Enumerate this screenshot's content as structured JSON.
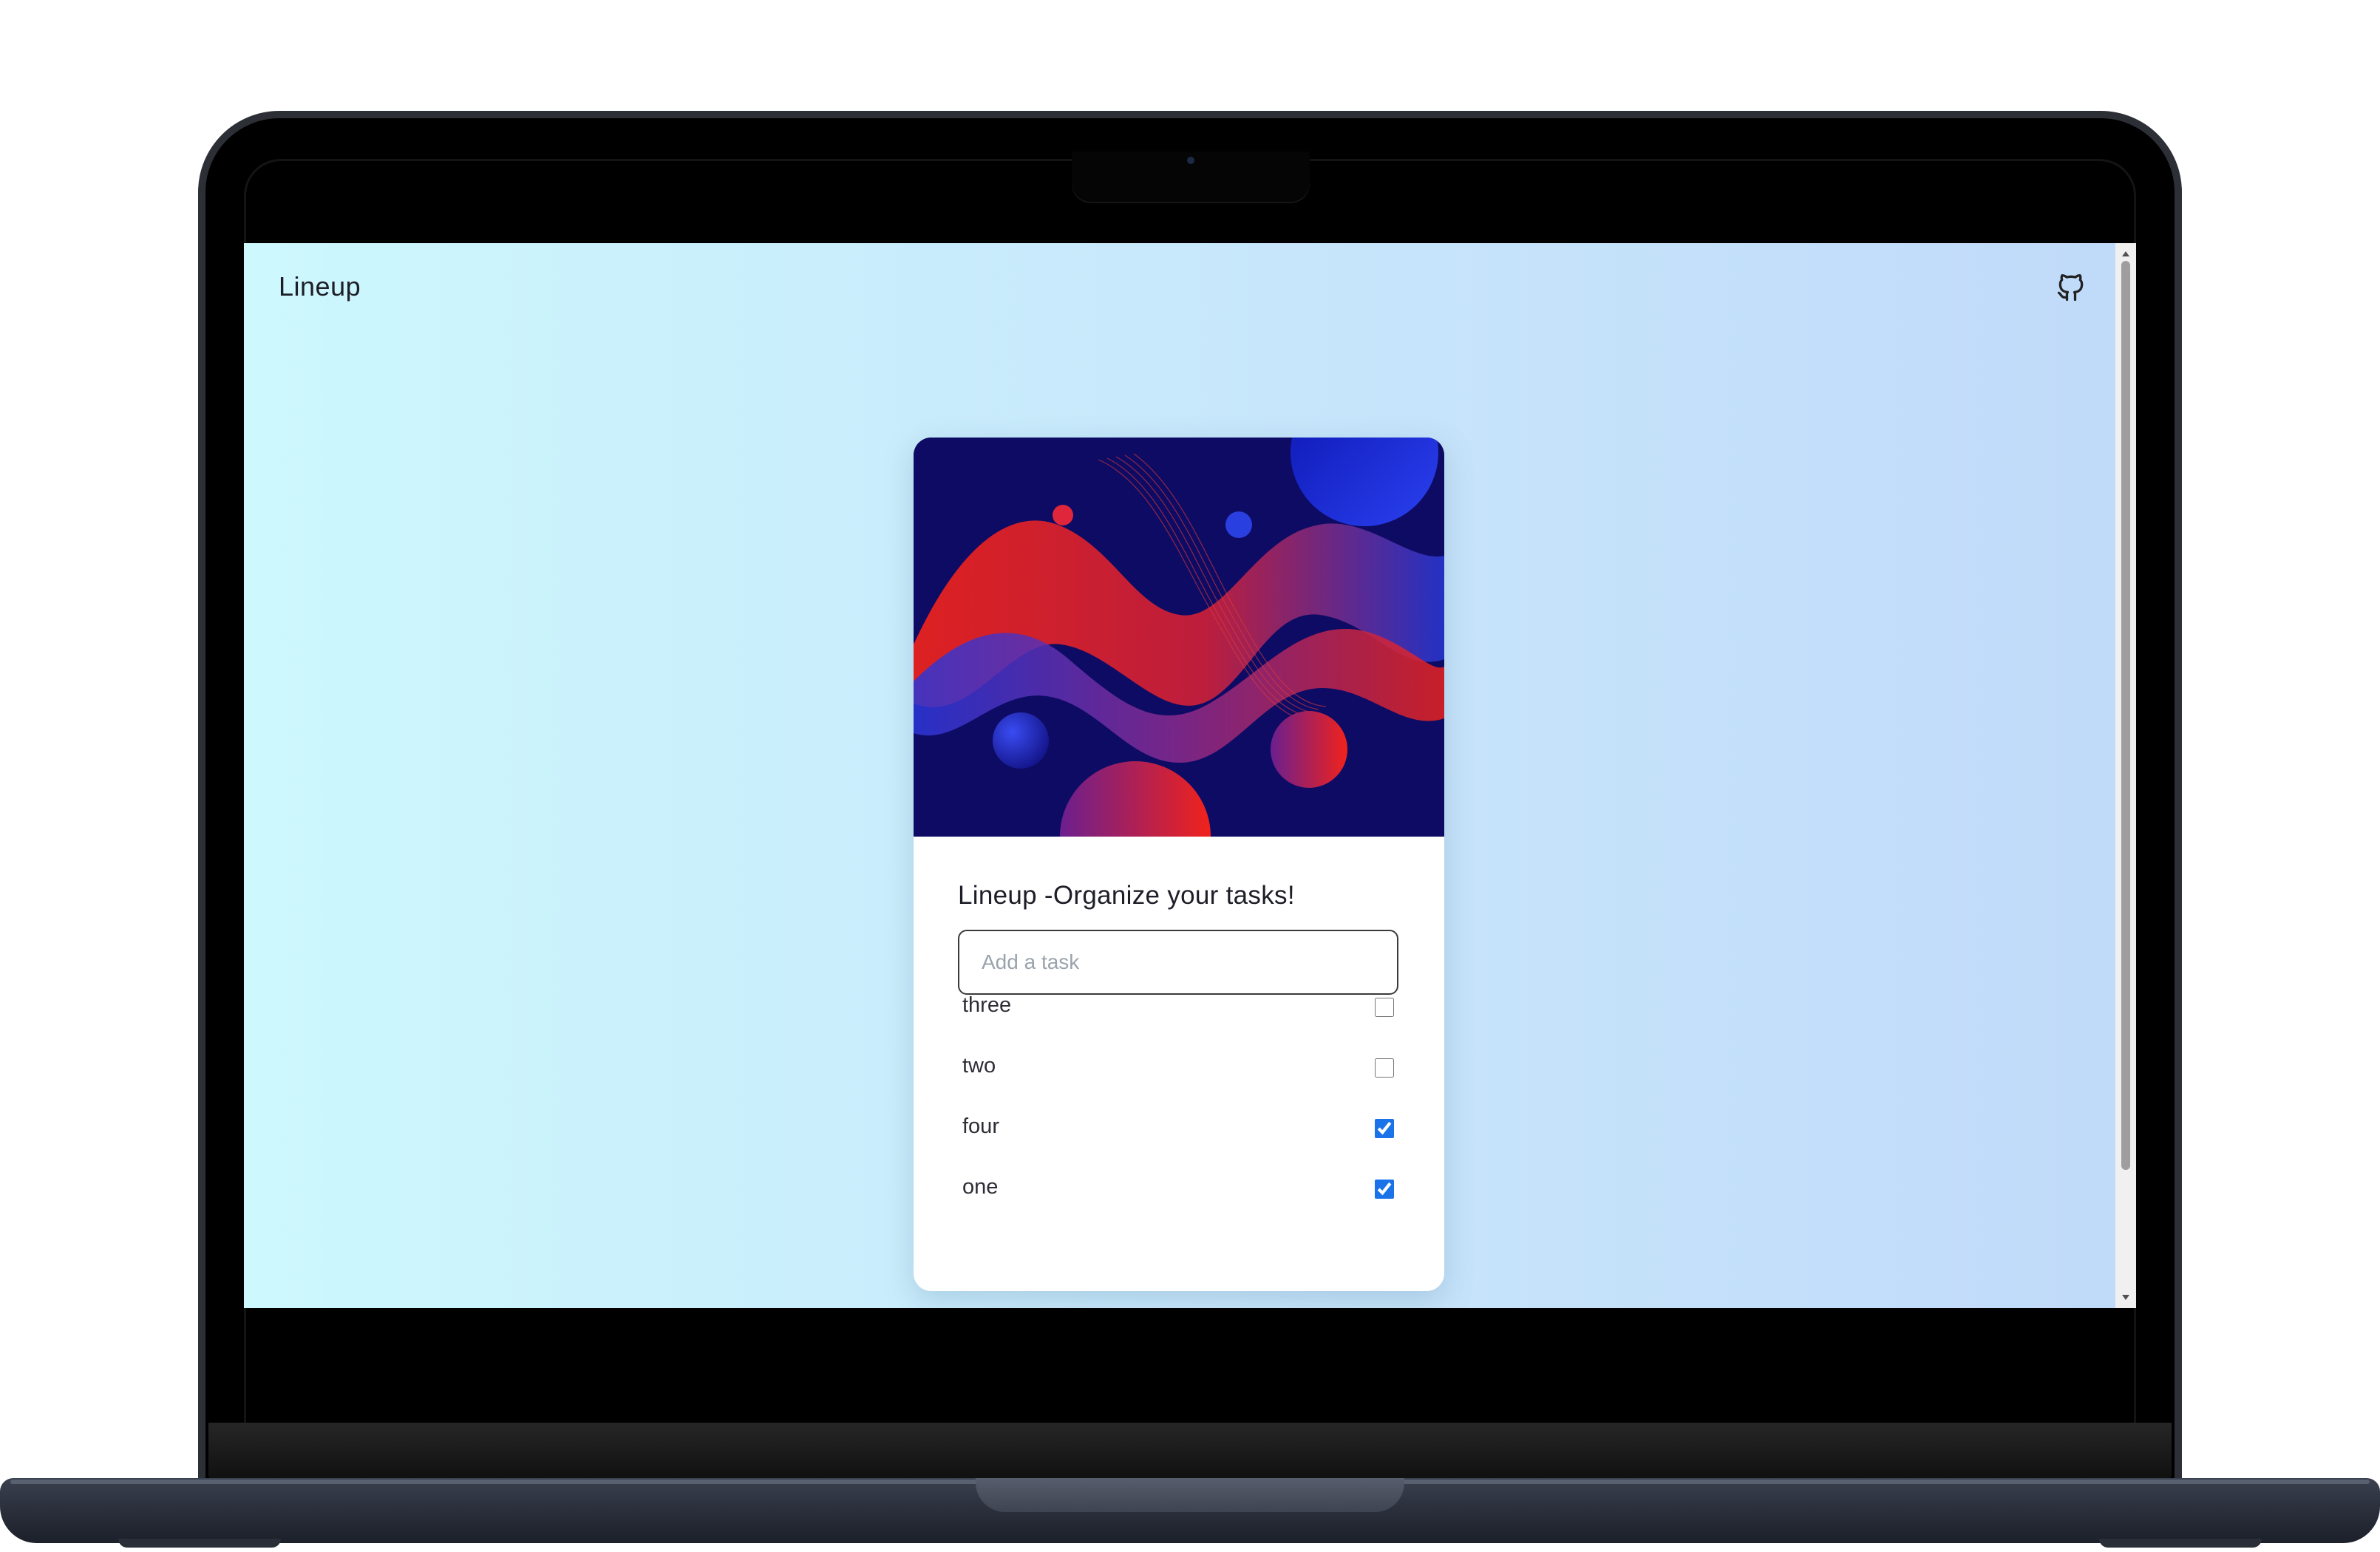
{
  "app": {
    "title": "Lineup",
    "github_icon": "github-icon"
  },
  "card": {
    "heading": "Lineup -Organize your tasks!",
    "input": {
      "placeholder": "Add a task",
      "value": ""
    },
    "tasks": [
      {
        "label": "three",
        "checked": false
      },
      {
        "label": "two",
        "checked": false
      },
      {
        "label": "four",
        "checked": true
      },
      {
        "label": "one",
        "checked": true
      }
    ]
  },
  "colors": {
    "background_left": "#cdf8fd",
    "background_right": "#c0daf9",
    "art_background": "#0e0b64",
    "accent_red": "#e8221e",
    "accent_blue": "#1a2fd6",
    "checkbox_checked": "#1a73e8"
  }
}
